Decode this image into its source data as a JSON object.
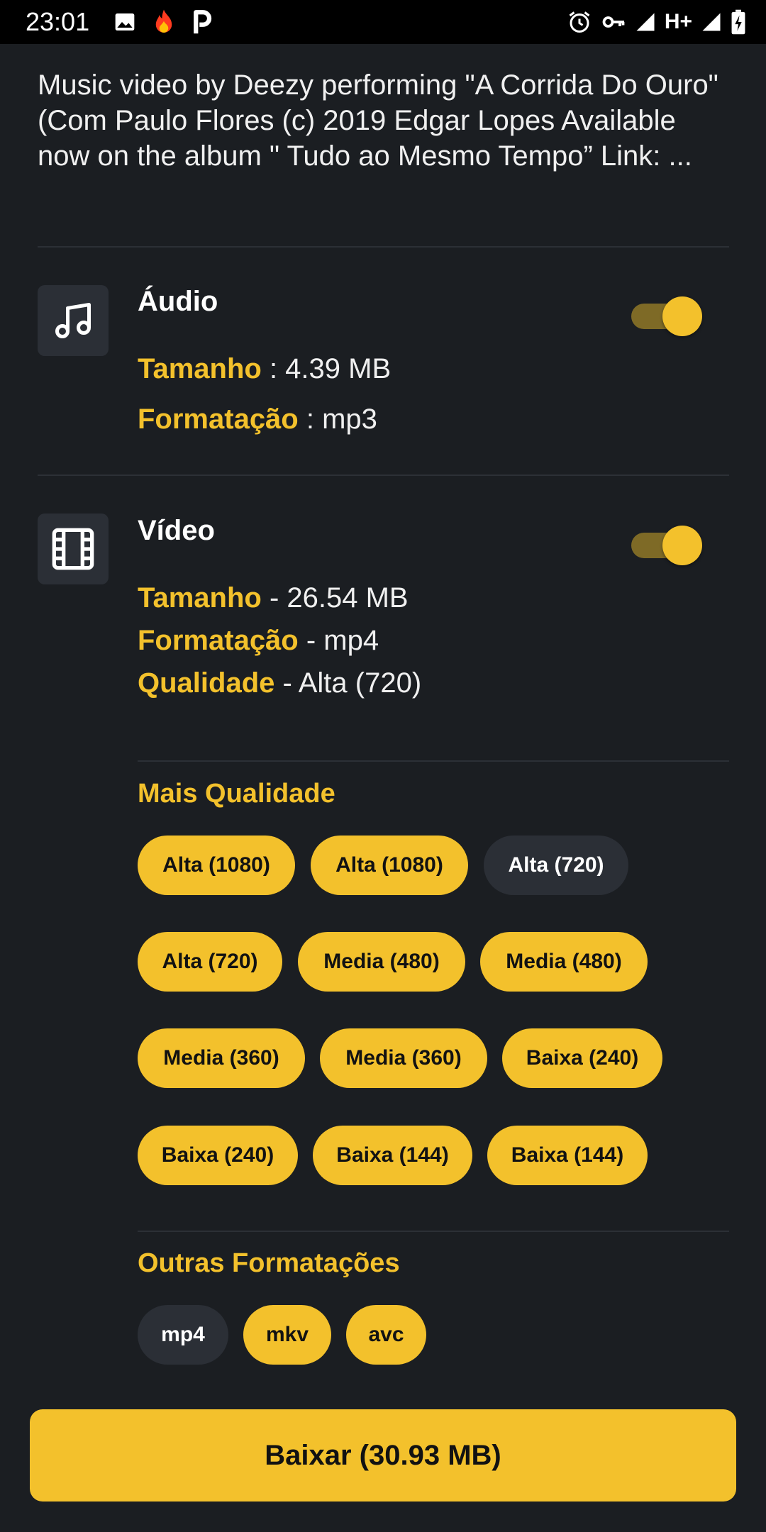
{
  "status_bar": {
    "time": "23:01",
    "network_label": "H+",
    "icons": [
      "image-icon",
      "fire-icon",
      "p-icon",
      "alarm-icon",
      "key-icon",
      "signal-icon",
      "battery-charging-icon"
    ]
  },
  "description": "Music video by Deezy performing \"A Corrida Do Ouro\" (Com Paulo Flores (c) 2019 Edgar Lopes Available now on the album \" Tudo ao Mesmo Tempo” Link: ...",
  "audio": {
    "title": "Áudio",
    "enabled": true,
    "size_label": "Tamanho",
    "size_value": " : 4.39 MB",
    "format_label": "Formatação",
    "format_value": " : mp3"
  },
  "video": {
    "title": "Vídeo",
    "enabled": true,
    "size_label": "Tamanho",
    "size_value": " - 26.54 MB",
    "format_label": "Formatação",
    "format_value": " - mp4",
    "quality_label": "Qualidade",
    "quality_value": " - Alta (720)"
  },
  "more_quality": {
    "heading": "Mais Qualidade",
    "options": [
      {
        "label": "Alta (1080)",
        "selected": false
      },
      {
        "label": "Alta (1080)",
        "selected": false
      },
      {
        "label": "Alta (720)",
        "selected": true
      },
      {
        "label": "Alta (720)",
        "selected": false
      },
      {
        "label": "Media (480)",
        "selected": false
      },
      {
        "label": "Media (480)",
        "selected": false
      },
      {
        "label": "Media (360)",
        "selected": false
      },
      {
        "label": "Media (360)",
        "selected": false
      },
      {
        "label": "Baixa (240)",
        "selected": false
      },
      {
        "label": "Baixa (240)",
        "selected": false
      },
      {
        "label": "Baixa (144)",
        "selected": false
      },
      {
        "label": "Baixa (144)",
        "selected": false
      }
    ]
  },
  "other_formats": {
    "heading": "Outras Formatações",
    "options": [
      {
        "label": "mp4",
        "selected": true
      },
      {
        "label": "mkv",
        "selected": false
      },
      {
        "label": "avc",
        "selected": false
      }
    ]
  },
  "download_button": "Baixar (30.93 MB)",
  "colors": {
    "accent": "#f3c12c",
    "background": "#1b1e22",
    "chip_dark": "#2b2f36"
  }
}
